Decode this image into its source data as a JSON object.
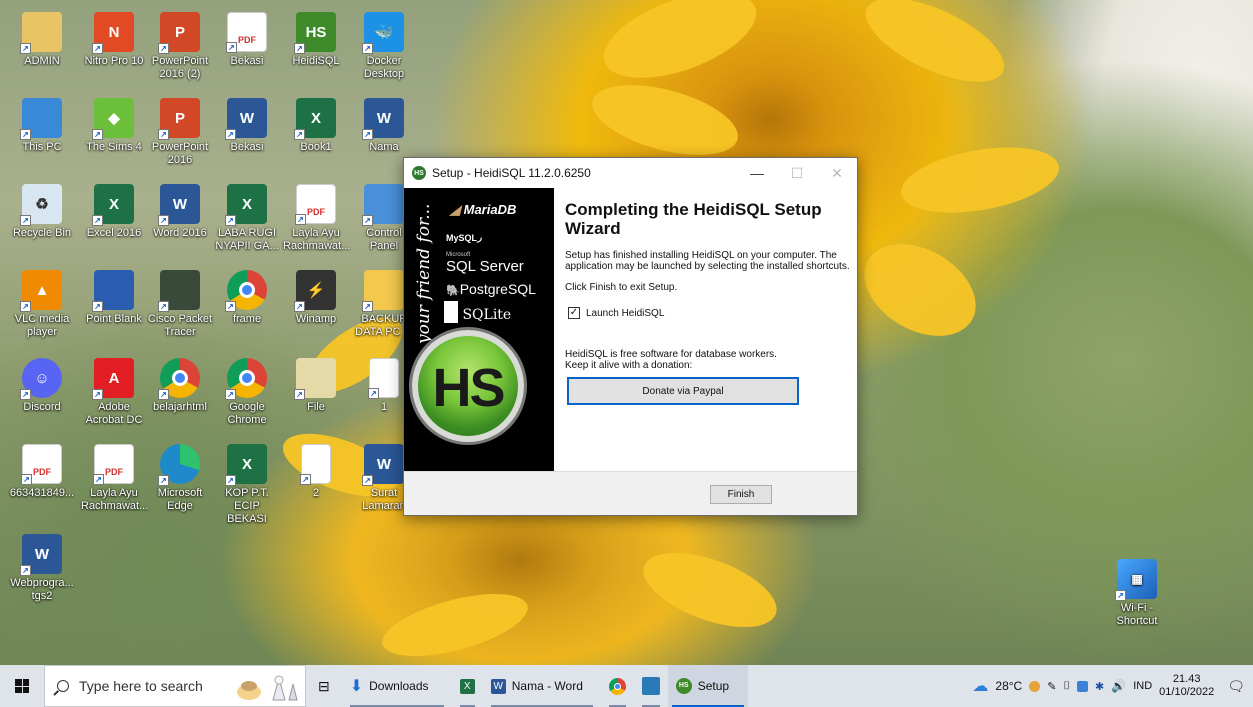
{
  "desktop": {
    "icons": [
      {
        "label": "ADMIN",
        "icon": "user-folder-icon",
        "color": "#e8c464",
        "glyph": ""
      },
      {
        "label": "Nitro Pro 10",
        "icon": "nitro-pdf-icon",
        "color": "#e24a24",
        "glyph": "N"
      },
      {
        "label": "PowerPoint 2016 (2)",
        "icon": "powerpoint-icon",
        "color": "#d24726",
        "glyph": "P"
      },
      {
        "label": "Bekasi",
        "icon": "pdf-icon",
        "color": "#ffffff",
        "glyph": "PDF"
      },
      {
        "label": "HeidiSQL",
        "icon": "heidisql-icon",
        "color": "#3f8a2a",
        "glyph": "HS"
      },
      {
        "label": "Docker Desktop",
        "icon": "docker-icon",
        "color": "#1d91e6",
        "glyph": "🐳"
      },
      {
        "label": "This PC",
        "icon": "computer-icon",
        "color": "#3a88d8",
        "glyph": ""
      },
      {
        "label": "The Sims 4",
        "icon": "sims-icon",
        "color": "#6bbf3a",
        "glyph": "◆"
      },
      {
        "label": "PowerPoint 2016",
        "icon": "powerpoint-icon",
        "color": "#d24726",
        "glyph": "P"
      },
      {
        "label": "Bekasi",
        "icon": "word-doc-icon",
        "color": "#2b5797",
        "glyph": "W"
      },
      {
        "label": "Book1",
        "icon": "excel-doc-icon",
        "color": "#1e7145",
        "glyph": "X"
      },
      {
        "label": "Nama",
        "icon": "word-doc-icon",
        "color": "#2b5797",
        "glyph": "W"
      },
      {
        "label": "Recycle Bin",
        "icon": "recycle-bin-icon",
        "color": "#d8e6f2",
        "glyph": "♻"
      },
      {
        "label": "Excel 2016",
        "icon": "excel-icon",
        "color": "#1e7145",
        "glyph": "X"
      },
      {
        "label": "Word 2016",
        "icon": "word-icon",
        "color": "#2b5797",
        "glyph": "W"
      },
      {
        "label": "LABA RUGI NYAPII GA...",
        "icon": "excel-doc-icon",
        "color": "#1e7145",
        "glyph": "X"
      },
      {
        "label": "Layla Ayu Rachmawat...",
        "icon": "pdf-icon",
        "color": "#ffffff",
        "glyph": "PDF"
      },
      {
        "label": "Control Panel",
        "icon": "control-panel-icon",
        "color": "#4a90d9",
        "glyph": ""
      },
      {
        "label": "VLC media player",
        "icon": "vlc-icon",
        "color": "#f08a00",
        "glyph": "▲"
      },
      {
        "label": "Point Blank",
        "icon": "point-blank-icon",
        "color": "#2a5db0",
        "glyph": ""
      },
      {
        "label": "Cisco Packet Tracer",
        "icon": "packet-tracer-icon",
        "color": "#3a4a3a",
        "glyph": ""
      },
      {
        "label": "frame",
        "icon": "chrome-icon",
        "color": "#ffffff",
        "glyph": ""
      },
      {
        "label": "Winamp",
        "icon": "winamp-icon",
        "color": "#333333",
        "glyph": "⚡"
      },
      {
        "label": "BACKUP DATA PC ...",
        "icon": "folder-icon",
        "color": "#f2c94c",
        "glyph": ""
      },
      {
        "label": "Discord",
        "icon": "discord-icon",
        "color": "#5865f2",
        "glyph": "☺"
      },
      {
        "label": "Adobe Acrobat DC",
        "icon": "acrobat-icon",
        "color": "#e21d24",
        "glyph": "A"
      },
      {
        "label": "belajarhtml",
        "icon": "chrome-icon",
        "color": "#ffffff",
        "glyph": ""
      },
      {
        "label": "Google Chrome",
        "icon": "chrome-icon",
        "color": "#ffffff",
        "glyph": ""
      },
      {
        "label": "File",
        "icon": "winrar-icon",
        "color": "#e6d9a8",
        "glyph": ""
      },
      {
        "label": "1",
        "icon": "text-file-icon",
        "color": "#ffffff",
        "glyph": ""
      },
      {
        "label": "663431849...",
        "icon": "pdf-icon",
        "color": "#ffffff",
        "glyph": "PDF"
      },
      {
        "label": "Layla Ayu Rachmawat...",
        "icon": "pdf-icon",
        "color": "#ffffff",
        "glyph": "PDF"
      },
      {
        "label": "Microsoft Edge",
        "icon": "edge-icon",
        "color": "#1f8ac9",
        "glyph": ""
      },
      {
        "label": "KOP P.T. ECIP BEKASI",
        "icon": "excel-doc-icon",
        "color": "#1e7145",
        "glyph": "X"
      },
      {
        "label": "2",
        "icon": "text-file-icon",
        "color": "#ffffff",
        "glyph": ""
      },
      {
        "label": "Surat Lamaran",
        "icon": "word-doc-icon",
        "color": "#2b5797",
        "glyph": "W"
      },
      {
        "label": "Webprogra... tgs2",
        "icon": "word-doc-icon",
        "color": "#2b5797",
        "glyph": "W"
      }
    ],
    "wifi_shortcut": {
      "label": "Wi-Fi - Shortcut",
      "icon": "wifi-network-icon"
    }
  },
  "window": {
    "title": "Setup - HeidiSQL 11.2.0.6250",
    "minimize": "—",
    "maximize": "☐",
    "close": "✕",
    "sidebar": {
      "tagline": "your friend for...",
      "databases": [
        "MariaDB",
        "MySQL",
        "SQL Server",
        "PostgreSQL",
        "SQLite"
      ],
      "microsoft_small": "Microsoft",
      "logo_text": "HS"
    },
    "heading": "Completing the HeidiSQL Setup Wizard",
    "paragraph1": "Setup has finished installing HeidiSQL on your computer. The application may be launched by selecting the installed shortcuts.",
    "paragraph2": "Click Finish to exit Setup.",
    "checkbox_label": "Launch HeidiSQL",
    "checkbox_checked": true,
    "donation_text": "HeidiSQL is free software for database workers. Keep it alive with a donation:",
    "donate_button": "Donate via Paypal",
    "finish_button": "Finish"
  },
  "taskbar": {
    "search_placeholder": "Type here to search",
    "items": [
      {
        "label": "Downloads",
        "icon": "downloads-folder-icon"
      },
      {
        "label": "",
        "icon": "excel-taskbar-icon"
      },
      {
        "label": "Nama - Word",
        "icon": "word-taskbar-icon"
      },
      {
        "label": "",
        "icon": "chrome-taskbar-icon"
      },
      {
        "label": "",
        "icon": "access-taskbar-icon"
      },
      {
        "label": "Setup",
        "icon": "heidisql-taskbar-icon"
      }
    ],
    "weather": "28°C",
    "language": "IND",
    "time": "21.43",
    "date": "01/10/2022"
  }
}
